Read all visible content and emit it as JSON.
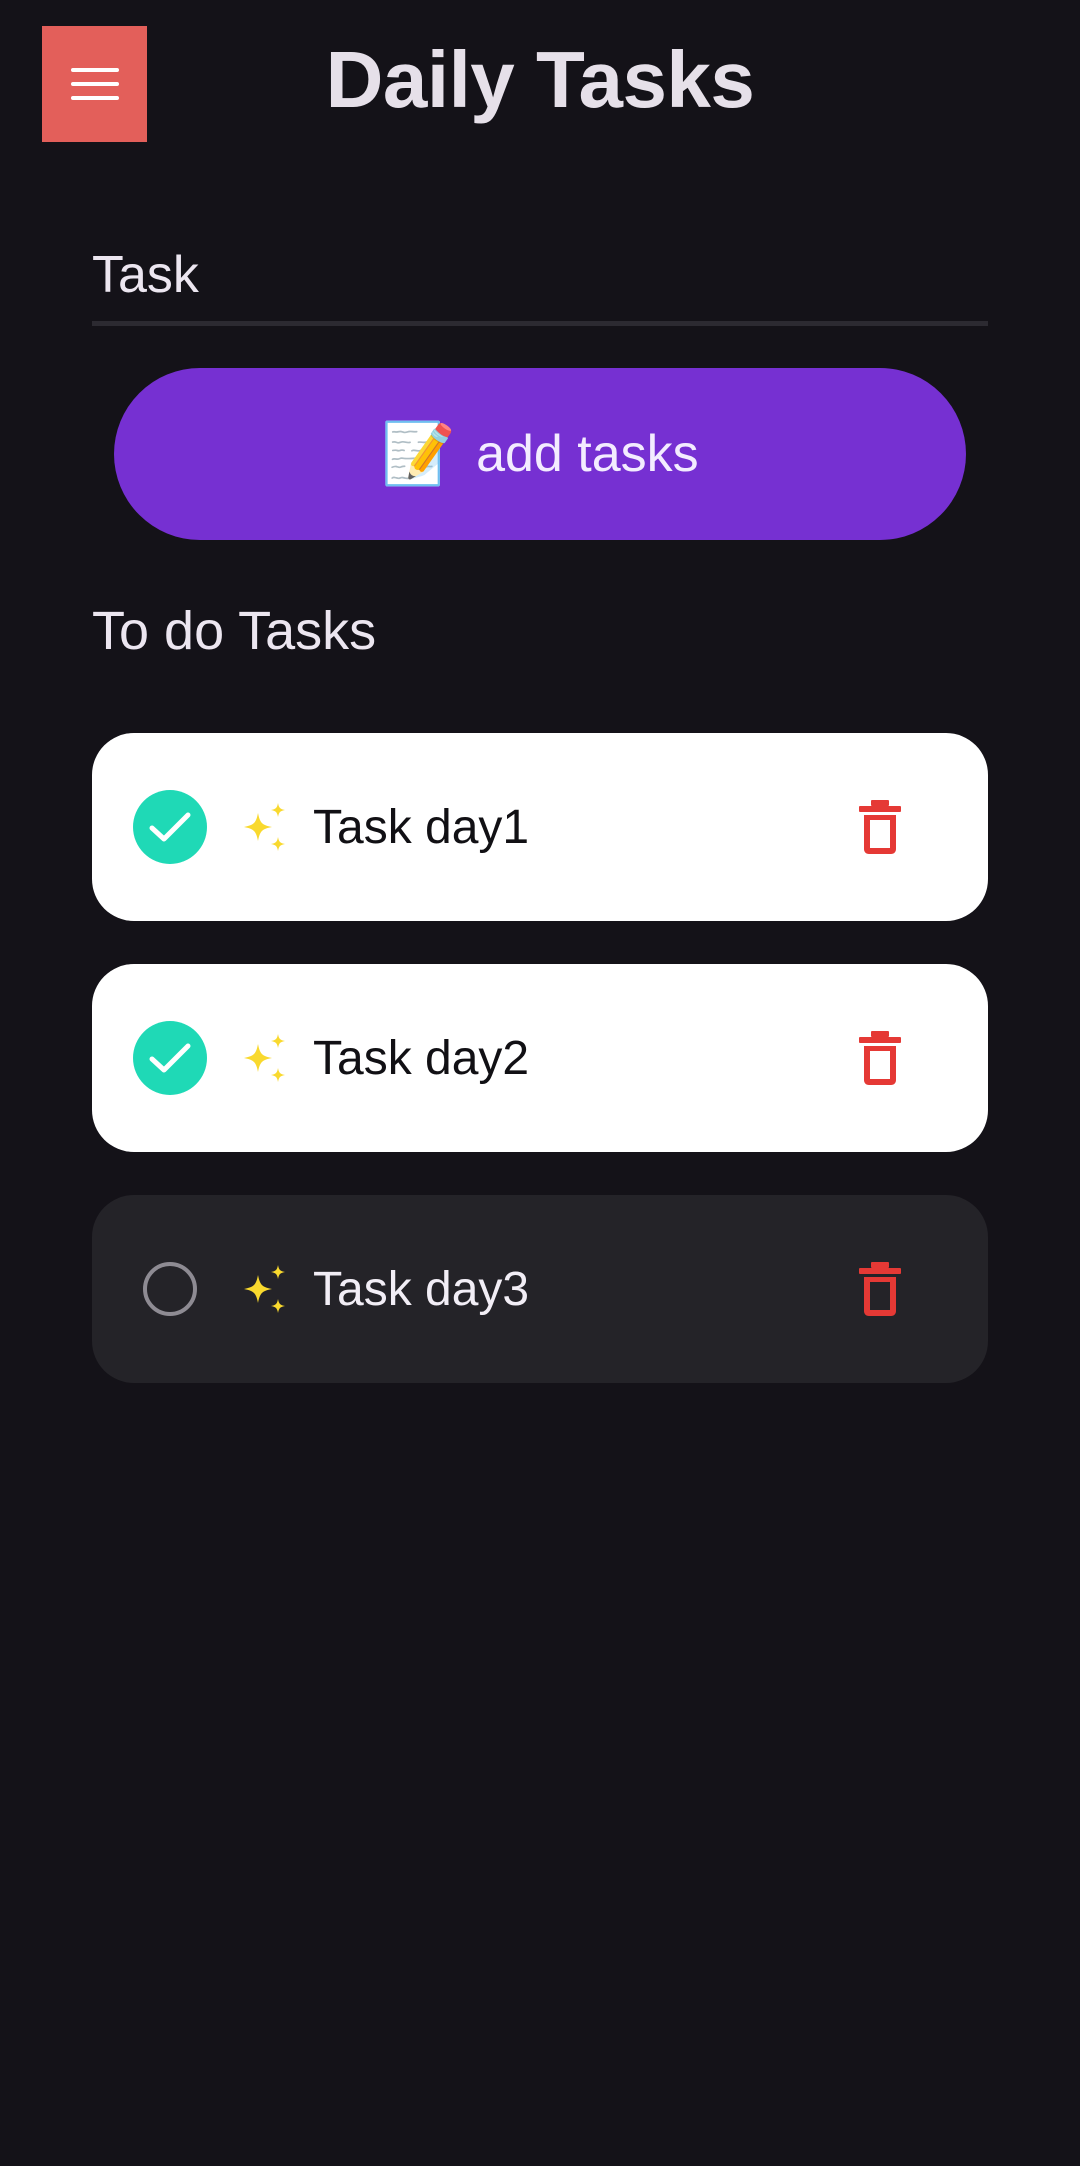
{
  "header": {
    "title": "Daily Tasks",
    "menu_icon": "hamburger-menu-icon"
  },
  "input": {
    "placeholder": "Task",
    "value": ""
  },
  "add_button": {
    "emoji": "📝",
    "label": "add tasks"
  },
  "section": {
    "heading": "To do Tasks"
  },
  "tasks": [
    {
      "label": "Task day1",
      "completed": true
    },
    {
      "label": "Task day2",
      "completed": true
    },
    {
      "label": "Task day3",
      "completed": false
    }
  ],
  "colors": {
    "background": "#141218",
    "menu_button": "#e35f5a",
    "accent_purple": "#7630d2",
    "check_teal": "#1fd9b6",
    "delete_red": "#e53935",
    "sparkle_yellow": "#f9d92e",
    "card_done": "#ffffff",
    "card_pending": "#242328"
  }
}
